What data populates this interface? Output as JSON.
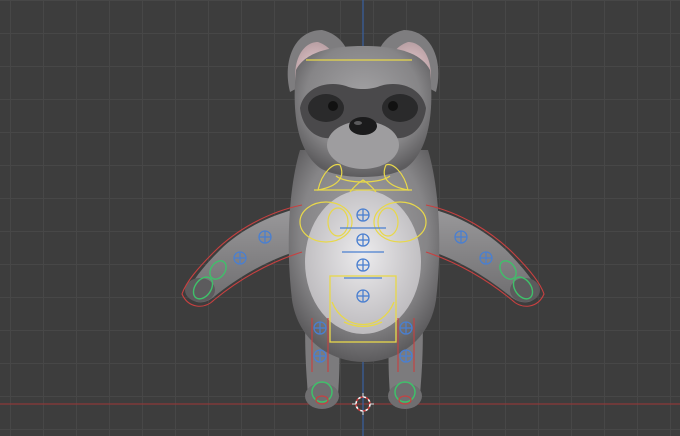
{
  "viewport": {
    "mode": "3D viewport",
    "colors": {
      "background": "#3d3d3d",
      "grid": "#474747",
      "x_axis": "#8b3a3a",
      "z_axis": "#3a5f9a",
      "rig_yellow": "#e8d84a",
      "rig_blue": "#4a7fd0",
      "rig_green": "#3fc06a",
      "rig_red": "#c84040",
      "mesh_fur": "#8b8a8c",
      "mesh_belly": "#d9d7d9"
    },
    "objects": {
      "mesh": "raccoon-character-mesh",
      "armature": "character-rig-controls",
      "cursor": "3d-cursor-icon"
    }
  }
}
